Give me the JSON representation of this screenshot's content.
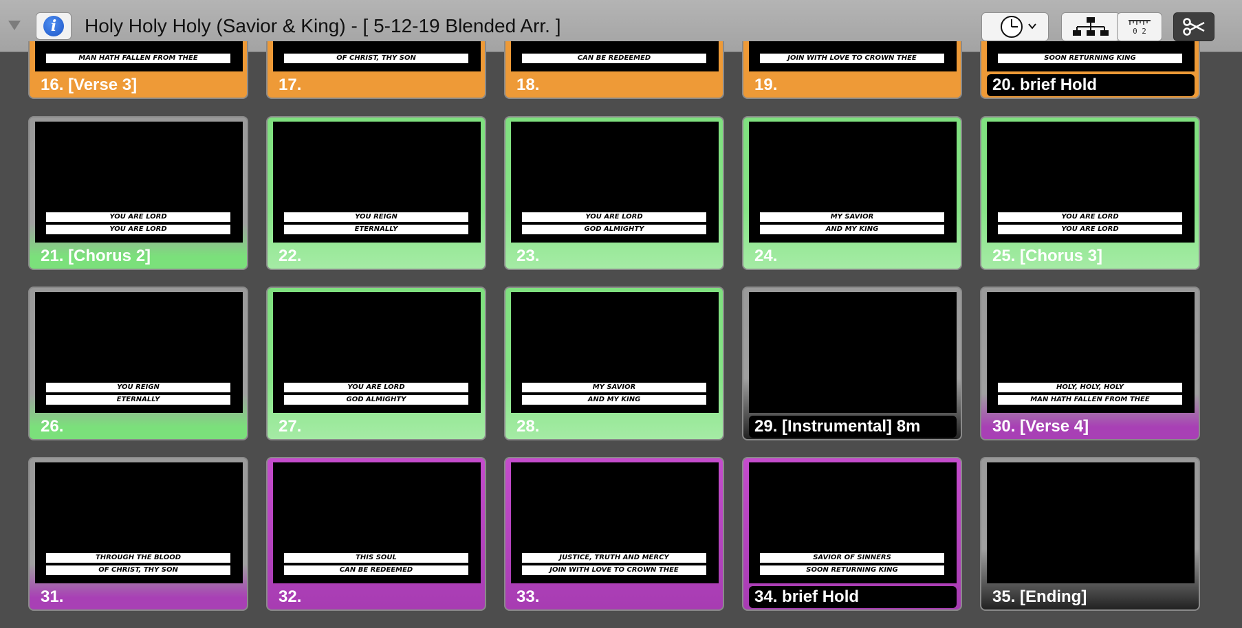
{
  "window": {
    "title": "Holy Holy Holy (Savior & King) - [ 5-12-19 Blended Arr. ]",
    "info_icon_glyph": "i"
  },
  "toolbar": {
    "clock_icon": "clock-icon",
    "tree_icon": "hierarchy-icon",
    "ruler_icon": "ruler-icon",
    "ruler_text": "0 2",
    "scissor_icon": "scissors-icon"
  },
  "colors": {
    "orange": "#ee9a37",
    "green": "#7fe07f",
    "purple": "#b344bf",
    "background": "#4d4d4d"
  },
  "slides": [
    {
      "label": "16. [Verse 3]",
      "lines": [
        "MAN HATH FALLEN FROM THEE"
      ],
      "group": "orange",
      "label_dark": false
    },
    {
      "label": "17.",
      "lines": [
        "OF CHRIST, THY SON"
      ],
      "group": "orange",
      "label_dark": false
    },
    {
      "label": "18.",
      "lines": [
        "CAN BE REDEEMED"
      ],
      "group": "orange",
      "label_dark": false
    },
    {
      "label": "19.",
      "lines": [
        "JOIN WITH LOVE TO CROWN THEE"
      ],
      "group": "orange",
      "label_dark": false
    },
    {
      "label": "20. brief Hold",
      "lines": [
        "SOON RETURNING KING"
      ],
      "group": "orange",
      "label_dark": true
    },
    {
      "label": "21. [Chorus 2]",
      "lines": [
        "YOU ARE LORD",
        "YOU ARE LORD"
      ],
      "group": "green",
      "label_dark": false
    },
    {
      "label": "22.",
      "lines": [
        "YOU REIGN",
        "ETERNALLY"
      ],
      "group": "green",
      "label_dark": false
    },
    {
      "label": "23.",
      "lines": [
        "YOU ARE LORD",
        "GOD ALMIGHTY"
      ],
      "group": "green",
      "label_dark": false
    },
    {
      "label": "24.",
      "lines": [
        "MY SAVIOR",
        "AND MY KING"
      ],
      "group": "green",
      "label_dark": false
    },
    {
      "label": "25. [Chorus 3]",
      "lines": [
        "YOU ARE LORD",
        "YOU ARE LORD"
      ],
      "group": "green",
      "label_dark": false
    },
    {
      "label": "26.",
      "lines": [
        "YOU REIGN",
        "ETERNALLY"
      ],
      "group": "green",
      "label_dark": false
    },
    {
      "label": "27.",
      "lines": [
        "YOU ARE LORD",
        "GOD ALMIGHTY"
      ],
      "group": "green",
      "label_dark": false
    },
    {
      "label": "28.",
      "lines": [
        "MY SAVIOR",
        "AND MY KING"
      ],
      "group": "green",
      "label_dark": false
    },
    {
      "label": "29. [Instrumental] 8m",
      "lines": [],
      "group": "black",
      "label_dark": true
    },
    {
      "label": "30. [Verse 4]",
      "lines": [
        "HOLY, HOLY, HOLY",
        "MAN HATH FALLEN FROM THEE"
      ],
      "group": "purple",
      "label_dark": false
    },
    {
      "label": "31.",
      "lines": [
        "THROUGH THE BLOOD",
        "OF CHRIST, THY SON"
      ],
      "group": "purple",
      "label_dark": false
    },
    {
      "label": "32.",
      "lines": [
        "THIS SOUL",
        "CAN BE REDEEMED"
      ],
      "group": "purple",
      "label_dark": false
    },
    {
      "label": "33.",
      "lines": [
        "JUSTICE, TRUTH AND MERCY",
        "JOIN WITH LOVE TO CROWN THEE"
      ],
      "group": "purple",
      "label_dark": false
    },
    {
      "label": "34. brief Hold",
      "lines": [
        "SAVIOR OF SINNERS",
        "SOON RETURNING KING"
      ],
      "group": "purple",
      "label_dark": true
    },
    {
      "label": "35. [Ending]",
      "lines": [],
      "group": "black",
      "label_dark": false
    }
  ]
}
